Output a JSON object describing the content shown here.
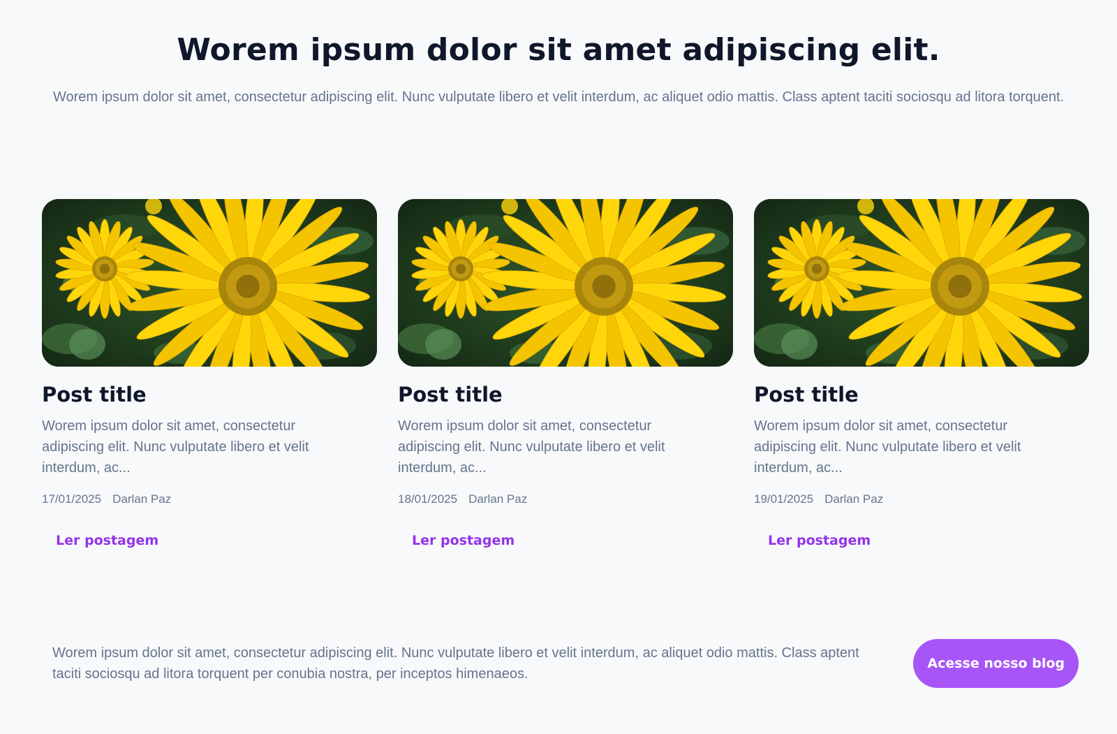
{
  "hero": {
    "title": "Worem ipsum dolor sit amet adipiscing elit.",
    "subtitle": "Worem ipsum dolor sit amet, consectetur adipiscing elit. Nunc vulputate libero et velit interdum, ac aliquet odio mattis. Class aptent taciti sociosqu ad litora torquent."
  },
  "posts": [
    {
      "title": "Post title",
      "excerpt": "Worem ipsum dolor sit amet, consectetur adipiscing elit. Nunc vulputate libero et velit interdum, ac...",
      "date": "17/01/2025",
      "author": "Darlan Paz",
      "link_label": "Ler postagem",
      "image_icon": "yellow-daisy-photo"
    },
    {
      "title": "Post title",
      "excerpt": "Worem ipsum dolor sit amet, consectetur adipiscing elit. Nunc vulputate libero et velit interdum, ac...",
      "date": "18/01/2025",
      "author": "Darlan Paz",
      "link_label": "Ler postagem",
      "image_icon": "yellow-daisy-photo"
    },
    {
      "title": "Post title",
      "excerpt": "Worem ipsum dolor sit amet, consectetur adipiscing elit. Nunc vulputate libero et velit interdum, ac...",
      "date": "19/01/2025",
      "author": "Darlan Paz",
      "link_label": "Ler postagem",
      "image_icon": "yellow-daisy-photo"
    }
  ],
  "footer": {
    "text": "Worem ipsum dolor sit amet, consectetur adipiscing elit. Nunc vulputate libero et velit interdum, ac aliquet odio mattis. Class aptent taciti sociosqu ad litora torquent per conubia nostra, per inceptos himenaeos.",
    "button_label": "Acesse nosso blog"
  },
  "colors": {
    "background": "#f8f9fb",
    "heading": "#0f172a",
    "body_text": "#64748b",
    "link": "#9333ea",
    "button": "#a855f7"
  }
}
